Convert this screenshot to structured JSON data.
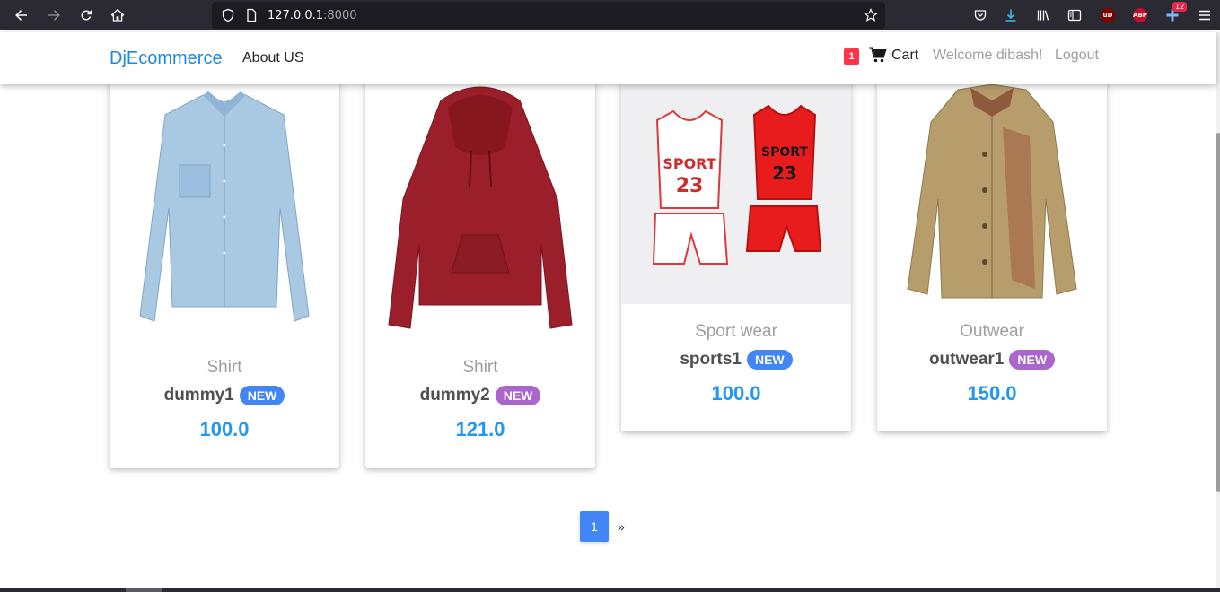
{
  "browser": {
    "url_host": "127.0.0.1",
    "url_port": ":8000",
    "abp_label": "ABP",
    "ublock_label": "uD",
    "notification_count": "12"
  },
  "navbar": {
    "brand": "DjEcommerce",
    "about": "About US",
    "cart_count": "1",
    "cart_label": "Cart",
    "welcome": "Welcome dibash!",
    "logout": "Logout"
  },
  "products": [
    {
      "category": "Shirt",
      "name": "dummy1",
      "badge": "NEW",
      "price": "100.0",
      "badge_color": "#4285f4",
      "image": "denim-shirt"
    },
    {
      "category": "Shirt",
      "name": "dummy2",
      "badge": "NEW",
      "price": "121.0",
      "badge_color": "#aa66cc",
      "image": "red-hoodie"
    },
    {
      "category": "Sport wear",
      "name": "sports1",
      "badge": "NEW",
      "price": "100.0",
      "badge_color": "#4285f4",
      "image": "jersey-set"
    },
    {
      "category": "Outwear",
      "name": "outwear1",
      "badge": "NEW",
      "price": "150.0",
      "badge_color": "#aa66cc",
      "image": "khaki-jacket"
    }
  ],
  "pagination": {
    "current": "1",
    "next": "»"
  },
  "colors": {
    "accent": "#1e88e5",
    "price": "#2196f3",
    "cart_badge": "#ff3547"
  }
}
